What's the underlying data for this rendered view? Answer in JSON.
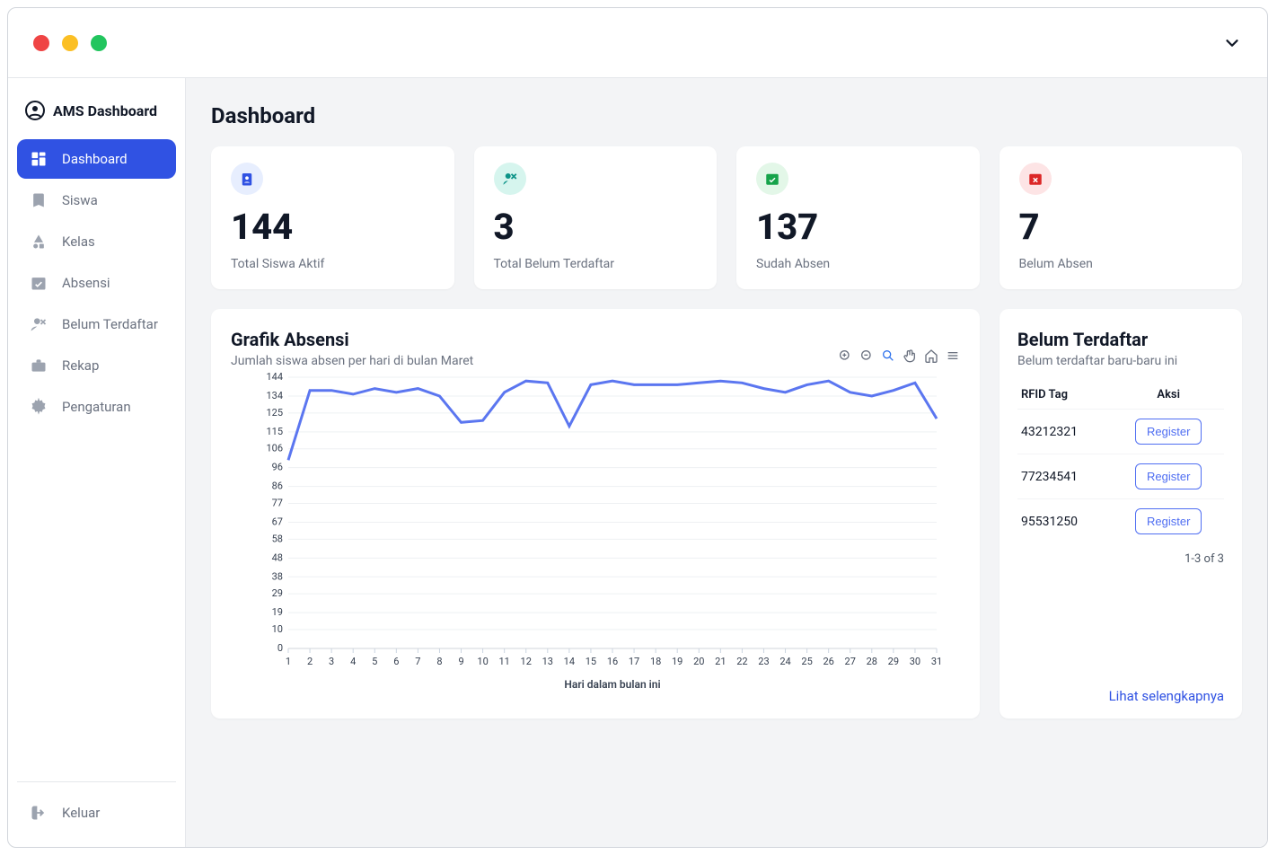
{
  "brand": {
    "name": "AMS Dashboard"
  },
  "sidebar": {
    "items": [
      {
        "label": "Dashboard",
        "active": true
      },
      {
        "label": "Siswa"
      },
      {
        "label": "Kelas"
      },
      {
        "label": "Absensi"
      },
      {
        "label": "Belum Terdaftar"
      },
      {
        "label": "Rekap"
      },
      {
        "label": "Pengaturan"
      }
    ],
    "logout_label": "Keluar"
  },
  "page": {
    "title": "Dashboard"
  },
  "stats": [
    {
      "value": "144",
      "label": "Total Siswa Aktif",
      "tone": "blue"
    },
    {
      "value": "3",
      "label": "Total Belum Terdaftar",
      "tone": "teal"
    },
    {
      "value": "137",
      "label": "Sudah Absen",
      "tone": "green"
    },
    {
      "value": "7",
      "label": "Belum Absen",
      "tone": "red"
    }
  ],
  "chart": {
    "title": "Grafik Absensi",
    "subtitle": "Jumlah siswa absen per hari di bulan Maret",
    "xlabel": "Hari dalam bulan ini"
  },
  "unreg": {
    "title": "Belum Terdaftar",
    "subtitle": "Belum terdaftar baru-baru ini",
    "col_tag": "RFID Tag",
    "col_action": "Aksi",
    "rows": [
      {
        "tag": "43212321",
        "action": "Register"
      },
      {
        "tag": "77234541",
        "action": "Register"
      },
      {
        "tag": "95531250",
        "action": "Register"
      }
    ],
    "pager": "1-3 of 3",
    "more": "Lihat selengkapnya"
  },
  "chart_data": {
    "type": "line",
    "title": "Grafik Absensi",
    "xlabel": "Hari dalam bulan ini",
    "ylabel": "",
    "ylim": [
      0,
      144
    ],
    "yticks": [
      0,
      10,
      19,
      29,
      38,
      48,
      58,
      67,
      77,
      86,
      96,
      106,
      115,
      125,
      134,
      144
    ],
    "x": [
      1,
      2,
      3,
      4,
      5,
      6,
      7,
      8,
      9,
      10,
      11,
      12,
      13,
      14,
      15,
      16,
      17,
      18,
      19,
      20,
      21,
      22,
      23,
      24,
      25,
      26,
      27,
      28,
      29,
      30,
      31
    ],
    "series": [
      {
        "name": "Absensi",
        "values": [
          100,
          137,
          137,
          135,
          138,
          136,
          138,
          134,
          120,
          121,
          136,
          142,
          141,
          118,
          140,
          142,
          140,
          140,
          140,
          141,
          142,
          141,
          138,
          136,
          140,
          142,
          136,
          134,
          137,
          141,
          122
        ]
      }
    ]
  }
}
